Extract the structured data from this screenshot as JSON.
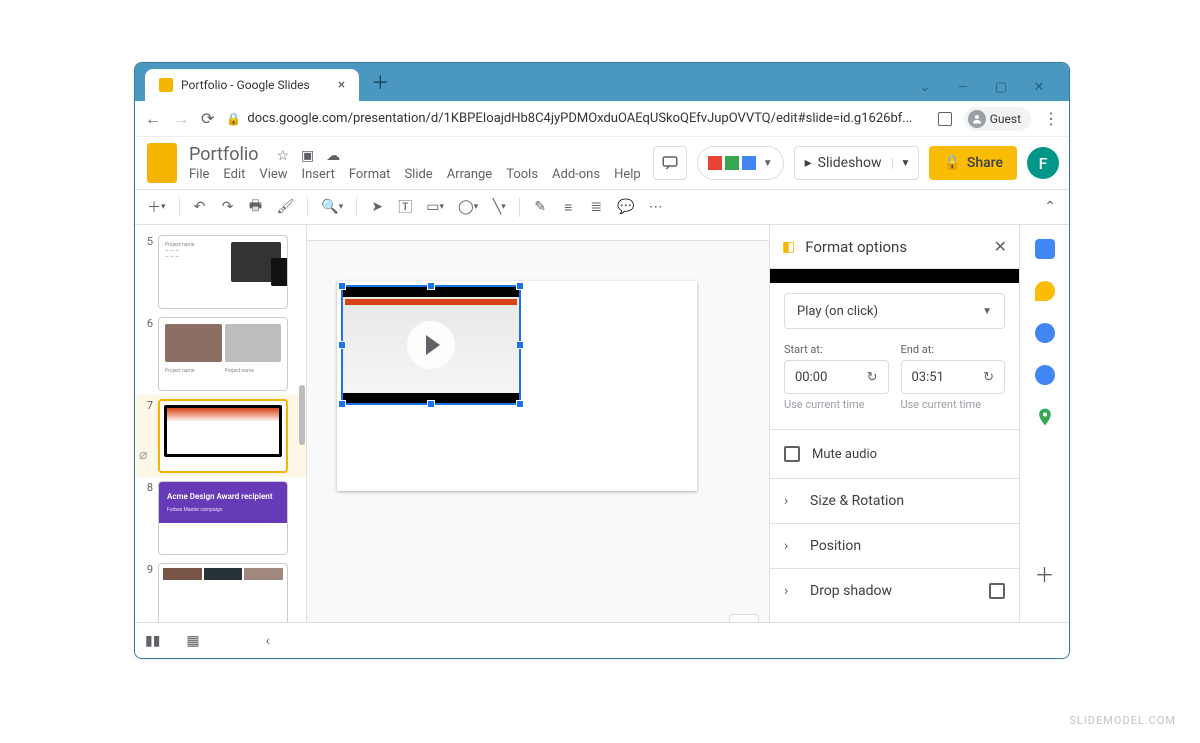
{
  "browser": {
    "tab_title": "Portfolio - Google Slides",
    "url": "docs.google.com/presentation/d/1KBPEIoajdHb8C4jyPDMOxduOAEqUSkoQEfvJupOVVTQ/edit#slide=id.g1626bf...",
    "guest_label": "Guest"
  },
  "app": {
    "doc_title": "Portfolio",
    "menus": [
      "File",
      "Edit",
      "View",
      "Insert",
      "Format",
      "Slide",
      "Arrange",
      "Tools",
      "Add-ons",
      "Help"
    ],
    "slideshow_label": "Slideshow",
    "share_label": "Share",
    "profile_initial": "F"
  },
  "filmstrip": {
    "slides": [
      {
        "num": "5"
      },
      {
        "num": "6"
      },
      {
        "num": "7"
      },
      {
        "num": "8",
        "title": "Acme Design Award recipient",
        "subtitle": "Forbes Master campaign"
      },
      {
        "num": "9"
      }
    ],
    "selected_index": 2
  },
  "format_panel": {
    "title": "Format options",
    "play_mode": "Play (on click)",
    "start_label": "Start at:",
    "end_label": "End at:",
    "start_value": "00:00",
    "end_value": "03:51",
    "use_current_time": "Use current time",
    "mute_label": "Mute audio",
    "sections": [
      "Size & Rotation",
      "Position",
      "Drop shadow"
    ]
  },
  "watermark": "SLIDEMODEL.COM"
}
